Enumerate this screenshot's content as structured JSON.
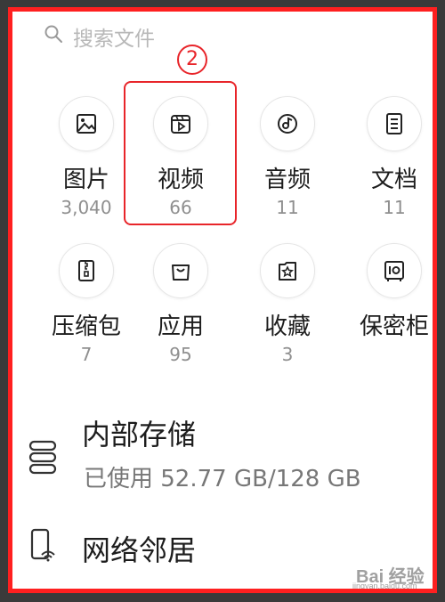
{
  "search": {
    "placeholder": "搜索文件",
    "icon": "search-icon"
  },
  "annotation": {
    "marker": "2"
  },
  "categories": [
    {
      "label": "图片",
      "count": "3,040",
      "icon": "image-icon"
    },
    {
      "label": "视频",
      "count": "66",
      "icon": "video-icon"
    },
    {
      "label": "音频",
      "count": "11",
      "icon": "music-icon"
    },
    {
      "label": "文档",
      "count": "11",
      "icon": "document-icon"
    },
    {
      "label": "压缩包",
      "count": "7",
      "icon": "archive-icon"
    },
    {
      "label": "应用",
      "count": "95",
      "icon": "app-bag-icon"
    },
    {
      "label": "收藏",
      "count": "3",
      "icon": "favorite-star-icon"
    },
    {
      "label": "保密柜",
      "count": "",
      "icon": "safe-icon"
    }
  ],
  "storage": {
    "title": "内部存储",
    "usage": "已使用 52.77 GB/128 GB",
    "icon": "storage-icon"
  },
  "network": {
    "title": "网络邻居",
    "icon": "network-phone-icon"
  },
  "watermark": {
    "brand": "Bai 经验",
    "url": "jingyan.baidu.com"
  },
  "colors": {
    "annotation": "#e8252a",
    "frame": "#ff2020",
    "text": "#1d1d1d",
    "muted": "#8f8f8f"
  }
}
